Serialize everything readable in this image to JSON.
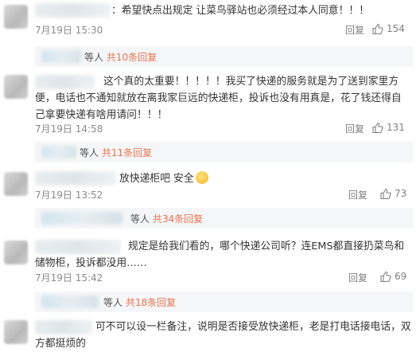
{
  "comments": [
    {
      "text": "：希望快点出规定 让菜鸟驿站也必须经过本人同意！！！",
      "date": "7月19日 15:30",
      "reply_label": "回复",
      "likes": "154",
      "thread_prefix": "等人",
      "thread_link": "共10条回复"
    },
    {
      "text": "这个真的太重要！！！！！我买了快递的服务就是为了送到家里方便，电话也不通知就放在离我家巨远的快递柜，投诉也没有用真是，花了钱还得自己拿要快递有啥用请问！！！",
      "date": "7月19日 14:58",
      "reply_label": "回复",
      "likes": "131",
      "thread_prefix": "等人",
      "thread_link": "共11条回复"
    },
    {
      "text": "放快递柜吧  安全",
      "date": "7月19日 13:52",
      "reply_label": "回复",
      "likes": "73",
      "thread_prefix": "等人",
      "thread_link": "共34条回复"
    },
    {
      "text": "规定是给我们看的，哪个快递公司听？连EMS都直接扔菜鸟和储物柜，投诉都没用……",
      "date": "7月19日 15:42",
      "reply_label": "回复",
      "likes": "69",
      "thread_prefix": "等人",
      "thread_link": "共18条回复"
    },
    {
      "text": "可不可以设一栏备注，说明是否接受放快递柜，老是打电话接电话，双方都挺烦的"
    }
  ]
}
